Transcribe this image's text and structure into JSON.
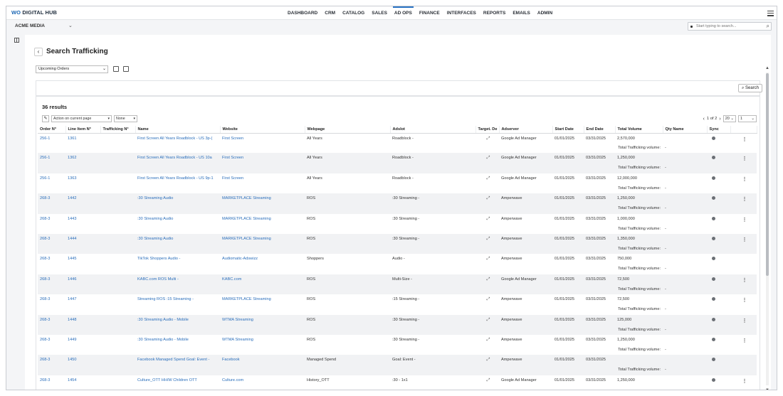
{
  "app": {
    "brand_prefix": "WO",
    "brand_name": "DIGITAL HUB"
  },
  "nav": {
    "items": [
      "DASHBOARD",
      "CRM",
      "CATALOG",
      "SALES",
      "AD OPS",
      "FINANCE",
      "INTERFACES",
      "REPORTS",
      "EMAILS",
      "ADMIN"
    ],
    "active": "AD OPS"
  },
  "org": {
    "name": "ACME MEDIA"
  },
  "global_search": {
    "placeholder": "Start typing to search..."
  },
  "page": {
    "title": "Search Trafficking",
    "view_selected": "Upcoming Orders",
    "search_label": "Search"
  },
  "results": {
    "count_label": "36 results",
    "bulk_action": "Action on current page",
    "bulk_filter": "None",
    "pagination": {
      "label": "1 of 2",
      "page_size": "20",
      "page": "1"
    },
    "columns": [
      "Order N°",
      "Line Item N°",
      "Trafficking N°",
      "Name",
      "Website",
      "Webpage",
      "Adslot",
      "Target. De",
      "Adserver",
      "Start Date",
      "End Date",
      "Total Volume",
      "Qty Name",
      "Sync"
    ],
    "sub_label": "Total Trafficking volume:",
    "rows": [
      {
        "order": "256-1",
        "line": "1361",
        "traf": "",
        "name": "First Screen All Years Roadblock - US 3p-(",
        "website": "First Screen",
        "webpage": "All Years",
        "adslot": "Roadblock -",
        "adserver": "Google Ad Manager",
        "start": "01/01/2025",
        "end": "03/31/2025",
        "volume": "2,570,000",
        "qty": "",
        "sub_value": "-",
        "menu": true
      },
      {
        "order": "256-1",
        "line": "1362",
        "traf": "",
        "name": "First Screen All Years Roadblock - US 10a",
        "website": "First Screen",
        "webpage": "All Years",
        "adslot": "Roadblock -",
        "adserver": "Google Ad Manager",
        "start": "01/01/2025",
        "end": "03/31/2025",
        "volume": "1,250,000",
        "qty": "",
        "sub_value": "-",
        "menu": true
      },
      {
        "order": "256-1",
        "line": "1363",
        "traf": "",
        "name": "First Screen All Years Roadblock - US 9p-1",
        "website": "First Screen",
        "webpage": "All Years",
        "adslot": "Roadblock -",
        "adserver": "Google Ad Manager",
        "start": "01/01/2025",
        "end": "03/31/2025",
        "volume": "12,000,000",
        "qty": "",
        "sub_value": "-",
        "menu": true
      },
      {
        "order": "268-3",
        "line": "1442",
        "traf": "",
        "name": ":30 Streaming Audio",
        "website": "MARKETPLACE Streaming",
        "webpage": "ROS",
        "adslot": ":30 Streaming -",
        "adserver": "Amperwave",
        "start": "01/01/2025",
        "end": "03/31/2025",
        "volume": "1,250,000",
        "qty": "",
        "sub_value": "-",
        "menu": true
      },
      {
        "order": "268-3",
        "line": "1443",
        "traf": "",
        "name": ":30 Streaming Audio",
        "website": "MARKETPLACE Streaming",
        "webpage": "ROS",
        "adslot": ":30 Streaming -",
        "adserver": "Amperwave",
        "start": "01/01/2025",
        "end": "03/31/2025",
        "volume": "1,000,000",
        "qty": "",
        "sub_value": "-",
        "menu": true
      },
      {
        "order": "268-3",
        "line": "1444",
        "traf": "",
        "name": ":30 Streaming Audio",
        "website": "MARKETPLACE Streaming",
        "webpage": "ROS",
        "adslot": ":30 Streaming -",
        "adserver": "Amperwave",
        "start": "01/01/2025",
        "end": "03/31/2025",
        "volume": "1,350,000",
        "qty": "",
        "sub_value": "-",
        "menu": true
      },
      {
        "order": "268-3",
        "line": "1445",
        "traf": "",
        "name": "TikTok Shoppers Audio -",
        "website": "Audiomatic-Adswizz",
        "webpage": "Shoppers",
        "adslot": "Audio -",
        "adserver": "Amperwave",
        "start": "01/01/2025",
        "end": "03/31/2025",
        "volume": "750,000",
        "qty": "",
        "sub_value": "-",
        "menu": false
      },
      {
        "order": "268-3",
        "line": "1446",
        "traf": "",
        "name": "KABC.com ROS Multi -",
        "website": "KABC.com",
        "webpage": "ROS",
        "adslot": "Multi-Size -",
        "adserver": "Google Ad Manager",
        "start": "01/01/2025",
        "end": "03/31/2025",
        "volume": "72,500",
        "qty": "",
        "sub_value": "-",
        "menu": true
      },
      {
        "order": "268-3",
        "line": "1447",
        "traf": "",
        "name": "Streaming ROS :15 Streaming -",
        "website": "MARKETPLACE Streaming",
        "webpage": "ROS",
        "adslot": ":15 Streaming -",
        "adserver": "Amperwave",
        "start": "01/01/2025",
        "end": "03/31/2025",
        "volume": "72,500",
        "qty": "",
        "sub_value": "-",
        "menu": true
      },
      {
        "order": "268-3",
        "line": "1448",
        "traf": "",
        "name": ":30 Streaming Audio - Mobile",
        "website": "WTMA Streaming",
        "webpage": "ROS",
        "adslot": ":30 Streaming -",
        "adserver": "Amperwave",
        "start": "01/01/2025",
        "end": "03/31/2025",
        "volume": "125,000",
        "qty": "",
        "sub_value": "-",
        "menu": true
      },
      {
        "order": "268-3",
        "line": "1449",
        "traf": "",
        "name": ":30 Streaming Audio - Mobile",
        "website": "WTMA Streaming",
        "webpage": "ROS",
        "adslot": ":30 Streaming -",
        "adserver": "Amperwave",
        "start": "01/01/2025",
        "end": "03/31/2025",
        "volume": "1,250,000",
        "qty": "",
        "sub_value": "-",
        "menu": true
      },
      {
        "order": "268-3",
        "line": "1450",
        "traf": "",
        "name": "Facebook Managed Spend Goal: Event -",
        "website": "Facebook",
        "webpage": "Managed Spend",
        "adslot": "Goal: Event -",
        "adserver": "Amperwave",
        "start": "01/01/2025",
        "end": "03/31/2025",
        "volume": "",
        "qty": "",
        "sub_value": "-",
        "menu": false
      },
      {
        "order": "268-3",
        "line": "1454",
        "traf": "",
        "name": "Culture_OTT HH/W Children OTT",
        "website": "Culture.com",
        "webpage": "History_OTT",
        "adslot": ":30 - 1x1",
        "adserver": "Google Ad Manager",
        "start": "01/01/2025",
        "end": "03/31/2025",
        "volume": "1,250,000",
        "qty": "",
        "sub_value": "",
        "menu": true
      }
    ]
  },
  "icons": {
    "back": "chevron-left-icon",
    "target": "expand-arrows-icon",
    "sync": "sync-status-icon",
    "menu": "kebab-menu-icon"
  },
  "colors": {
    "link": "#2a6ebb",
    "active_nav": "#2a74c4",
    "row_shade": "#f1f2f4"
  }
}
